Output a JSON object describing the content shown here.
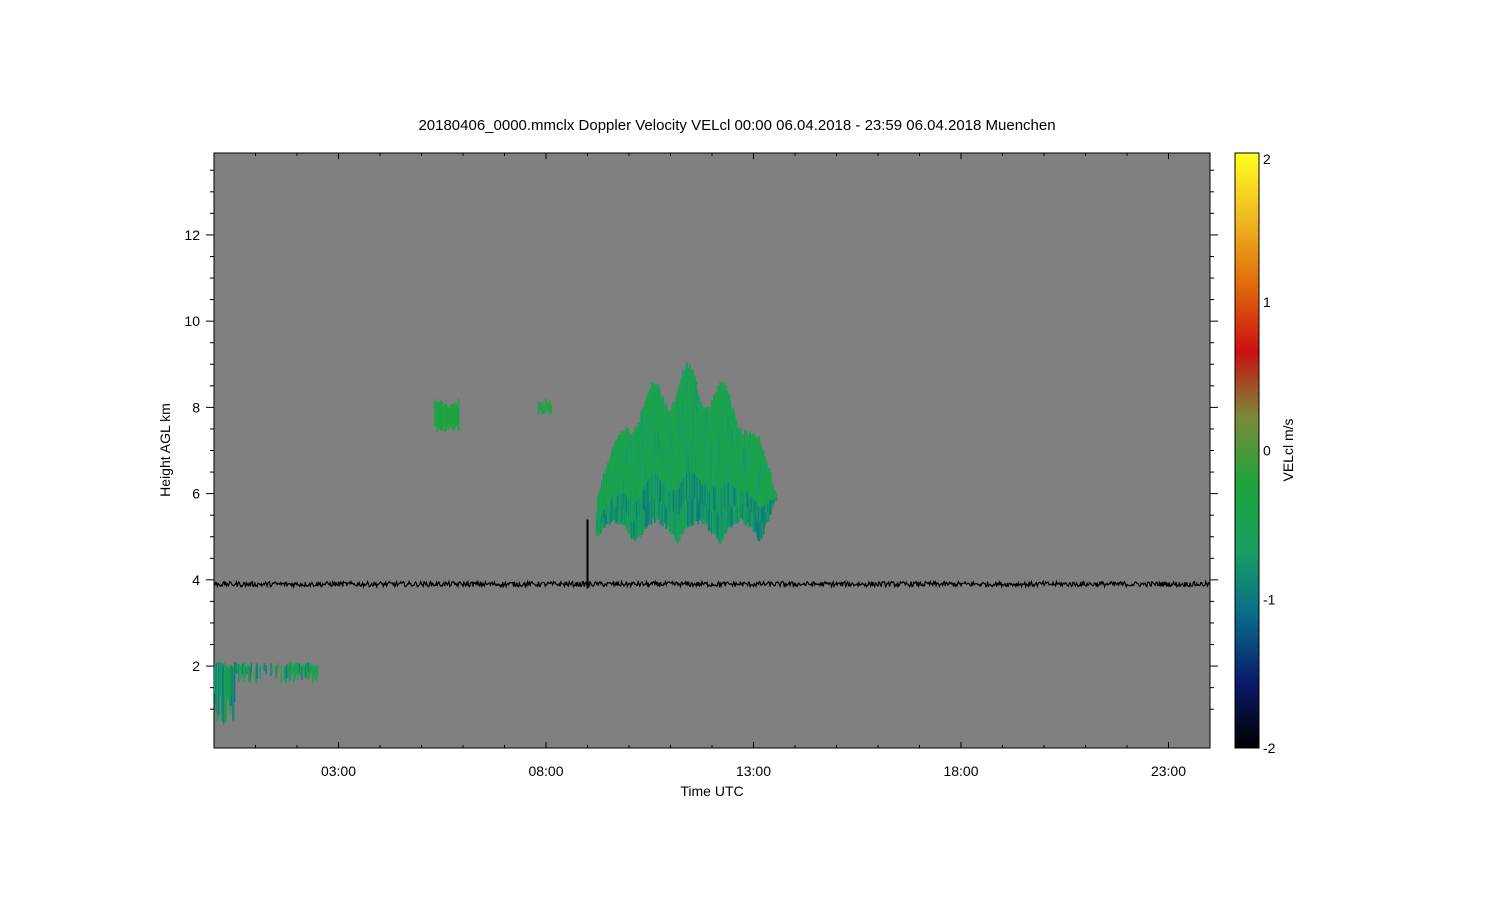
{
  "chart_data": {
    "type": "heatmap",
    "title": "20180406_0000.mmclx Doppler Velocity VELcl   00:00 06.04.2018 - 23:59 06.04.2018 Muenchen",
    "xlabel": "Time UTC",
    "ylabel": "Height AGL km",
    "xlim": [
      0,
      24
    ],
    "ylim": [
      0.1,
      13.9
    ],
    "x_ticks": [
      3,
      8,
      13,
      18,
      23
    ],
    "x_tick_labels": [
      "03:00",
      "08:00",
      "13:00",
      "18:00",
      "23:00"
    ],
    "y_ticks": [
      2,
      4,
      6,
      8,
      10,
      12
    ],
    "y_tick_labels": [
      "2",
      "4",
      "6",
      "8",
      "10",
      "12"
    ],
    "background_color": "#808080",
    "colorbar": {
      "label": "VELcl m/s",
      "range": [
        -2,
        2
      ],
      "ticks": [
        -2,
        -1,
        0,
        1,
        2
      ],
      "tick_labels": [
        "-2",
        "-1",
        "0",
        "1",
        "2"
      ],
      "colors": [
        "#000000",
        "#0a1a6a",
        "#0a6a8a",
        "#18a060",
        "#1ea43c",
        "#7a8a3a",
        "#cc1010",
        "#e06a0a",
        "#f0b820",
        "#ffff20"
      ]
    },
    "features": {
      "main_cloud": {
        "time_range": [
          9.2,
          13.8
        ],
        "height_range": [
          4.7,
          8.8
        ],
        "typical_velocity": -0.5
      },
      "small_patch_1": {
        "time_range": [
          5.3,
          5.9
        ],
        "height_range": [
          7.4,
          8.2
        ],
        "typical_velocity": -0.3
      },
      "small_patch_2": {
        "time_range": [
          7.8,
          8.1
        ],
        "height_range": [
          7.8,
          8.2
        ],
        "typical_velocity": -0.3
      },
      "low_cloud": {
        "time_range": [
          0.0,
          2.5
        ],
        "height_range": [
          0.6,
          2.1
        ],
        "typical_velocity": -0.6
      },
      "noise_line": {
        "height": 3.9
      },
      "spike": {
        "time": 9.0,
        "height_range": [
          3.8,
          5.4
        ]
      }
    }
  }
}
